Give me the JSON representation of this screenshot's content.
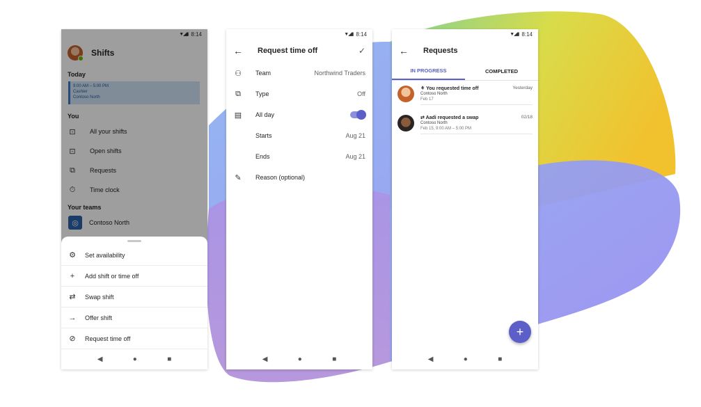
{
  "status_time": "8:14",
  "status_signal": "▼◢▮",
  "colors": {
    "accent": "#5b5fc7",
    "presence": "#6bb700",
    "shift_card": "#cfe4f7"
  },
  "nav": {
    "back": "◀",
    "home": "●",
    "recent": "■"
  },
  "shifts_screen": {
    "title": "Shifts",
    "today_label": "Today",
    "shift_time": "9:00 AM – 5:00 PM",
    "shift_role": "Cashier",
    "shift_location": "Contoso North",
    "you_label": "You",
    "you_items": [
      {
        "icon": "calendar-icon",
        "glyph": "⊡",
        "label": "All your shifts"
      },
      {
        "icon": "open-shifts-icon",
        "glyph": "⊡",
        "label": "Open shifts"
      },
      {
        "icon": "requests-icon",
        "glyph": "⧉",
        "label": "Requests"
      },
      {
        "icon": "stopwatch-icon",
        "glyph": "⏱",
        "label": "Time clock"
      }
    ],
    "teams_label": "Your teams",
    "team_name": "Contoso North",
    "sheet_items": [
      {
        "icon": "availability-icon",
        "glyph": "⚙",
        "label": "Set availability"
      },
      {
        "icon": "plus-icon",
        "glyph": "+",
        "label": "Add shift or time off"
      },
      {
        "icon": "swap-icon",
        "glyph": "⇄",
        "label": "Swap shift"
      },
      {
        "icon": "arrow-right-icon",
        "glyph": "→",
        "label": "Offer shift"
      },
      {
        "icon": "blocked-icon",
        "glyph": "⊘",
        "label": "Request time off"
      }
    ]
  },
  "time_off_screen": {
    "back": "←",
    "title": "Request time off",
    "confirm": "✓",
    "rows": {
      "team": {
        "label": "Team",
        "value": "Northwind Traders"
      },
      "type": {
        "label": "Type",
        "value": "Off"
      },
      "allday": {
        "label": "All day",
        "on": true
      },
      "starts": {
        "label": "Starts",
        "value": "Aug 21"
      },
      "ends": {
        "label": "Ends",
        "value": "Aug 21"
      },
      "reason": {
        "label": "Reason (optional)"
      }
    }
  },
  "requests_screen": {
    "back": "←",
    "title": "Requests",
    "tabs": [
      "IN PROGRESS",
      "COMPLETED"
    ],
    "items": [
      {
        "icon": "time-off-icon",
        "glyph": "⚘",
        "title": "You requested time off",
        "date": "Yesterday",
        "team": "Contoso North",
        "detail": "Feb 17"
      },
      {
        "icon": "swap-icon",
        "glyph": "⇄",
        "title": "Aadi requested a swap",
        "date": "02/18",
        "team": "Contoso North",
        "detail": "Feb 15, 9:00 AM – 5:00 PM"
      }
    ],
    "fab": "+"
  }
}
